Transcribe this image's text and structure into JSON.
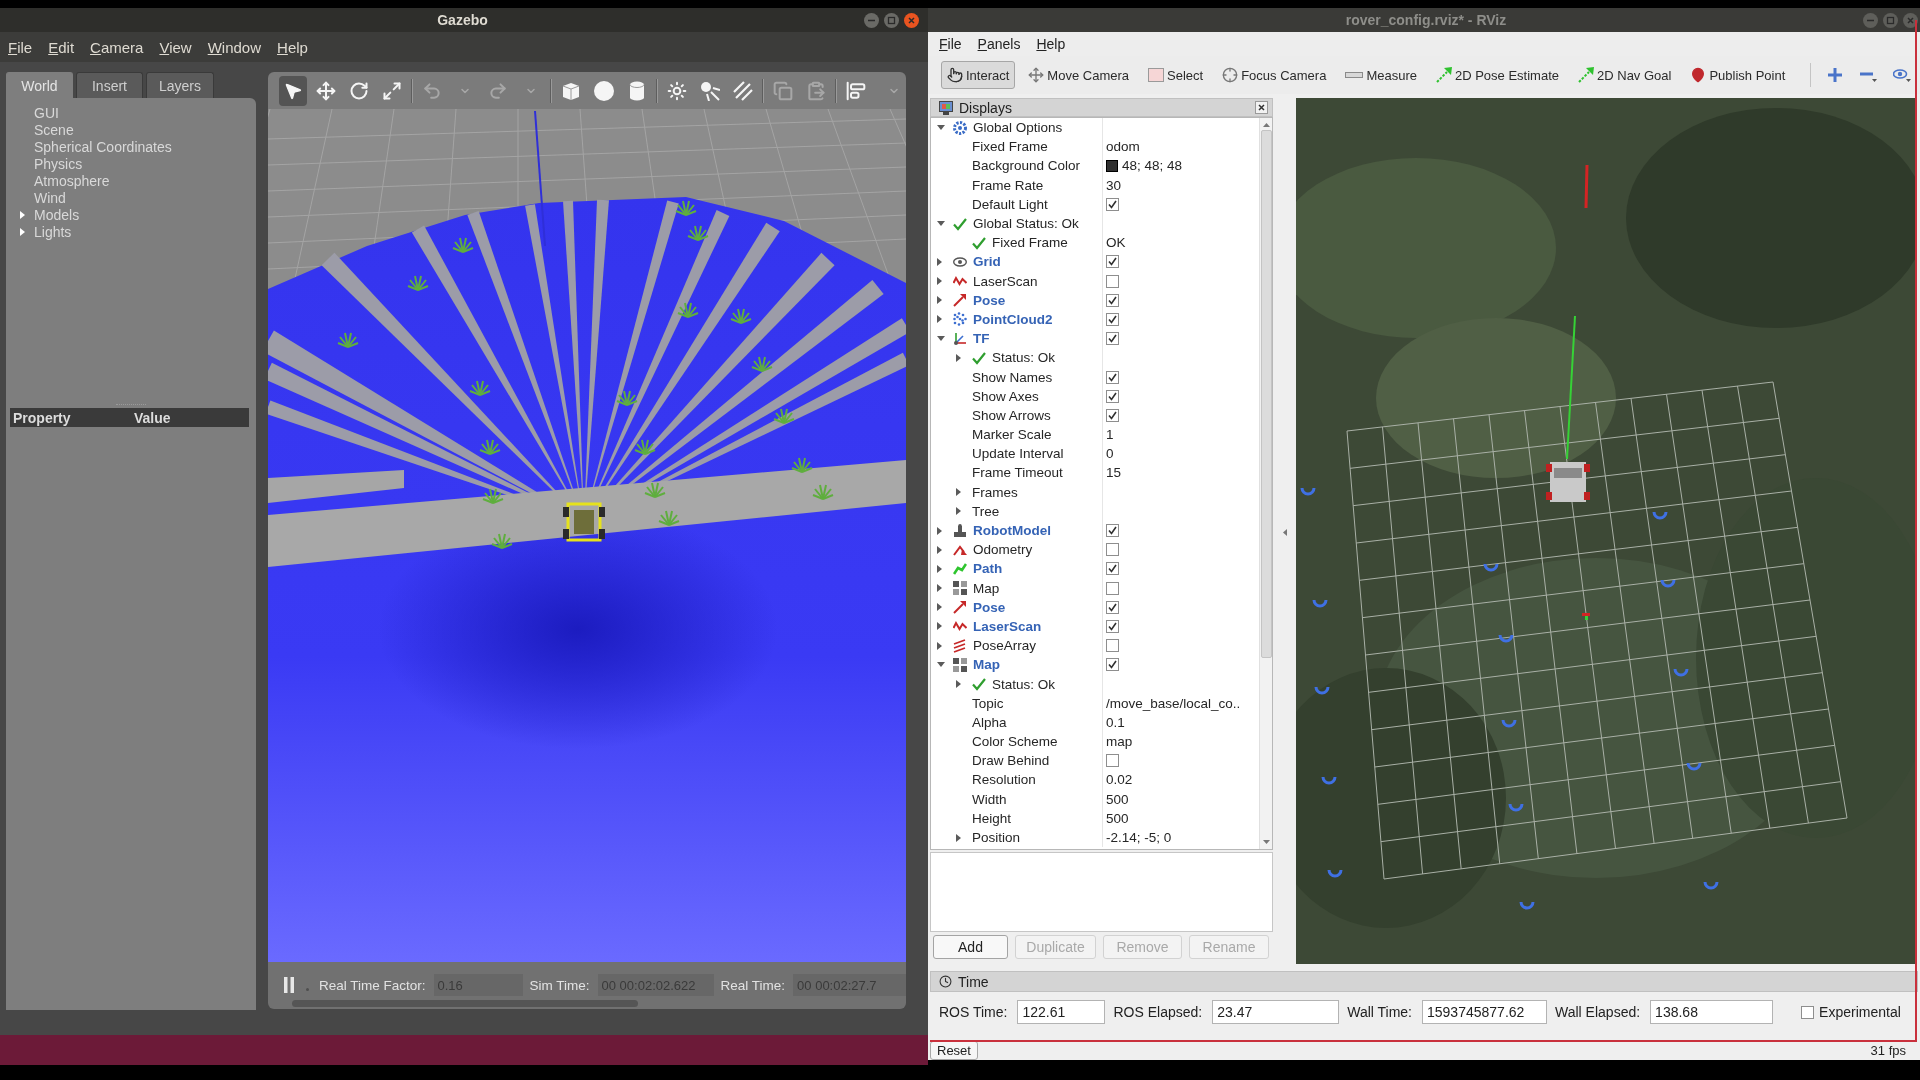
{
  "gazebo": {
    "window": {
      "title": "Gazebo"
    },
    "menu": [
      "File",
      "Edit",
      "Camera",
      "View",
      "Window",
      "Help"
    ],
    "tabs": [
      {
        "label": "World",
        "selected": true
      },
      {
        "label": "Insert",
        "selected": false
      },
      {
        "label": "Layers",
        "selected": false
      }
    ],
    "world_tree": [
      {
        "label": "GUI"
      },
      {
        "label": "Scene"
      },
      {
        "label": "Spherical Coordinates"
      },
      {
        "label": "Physics"
      },
      {
        "label": "Atmosphere"
      },
      {
        "label": "Wind"
      },
      {
        "label": "Models",
        "expanded": false
      },
      {
        "label": "Lights",
        "expanded": false
      }
    ],
    "property_table": {
      "columns": [
        "Property",
        "Value"
      ]
    },
    "toolbar": {
      "groups": [
        [
          {
            "kind": "select",
            "selected": true,
            "disabled": false
          },
          {
            "kind": "translate",
            "selected": false,
            "disabled": false
          },
          {
            "kind": "rotate",
            "selected": false,
            "disabled": false
          },
          {
            "kind": "scale",
            "selected": false,
            "disabled": false
          }
        ],
        [
          {
            "kind": "undo",
            "selected": false,
            "disabled": true
          },
          {
            "kind": "undo-menu",
            "selected": false,
            "disabled": true
          },
          {
            "kind": "redo",
            "selected": false,
            "disabled": true
          },
          {
            "kind": "redo-menu",
            "selected": false,
            "disabled": true
          }
        ],
        [
          {
            "kind": "box",
            "selected": false,
            "disabled": false
          },
          {
            "kind": "sphere",
            "selected": false,
            "disabled": false
          },
          {
            "kind": "cylinder",
            "selected": false,
            "disabled": false
          }
        ],
        [
          {
            "kind": "point-light",
            "selected": false,
            "disabled": false
          },
          {
            "kind": "spot-light",
            "selected": false,
            "disabled": false
          },
          {
            "kind": "directional-light",
            "selected": false,
            "disabled": false
          }
        ],
        [
          {
            "kind": "copy",
            "selected": false,
            "disabled": true
          },
          {
            "kind": "paste",
            "selected": false,
            "disabled": true
          }
        ],
        [
          {
            "kind": "align",
            "selected": false,
            "disabled": false
          },
          {
            "kind": "more",
            "selected": false,
            "disabled": true
          }
        ]
      ]
    },
    "status_bar": {
      "readouts": [
        {
          "label": "Real Time Factor:",
          "value": "0.16"
        },
        {
          "label": "Sim Time:",
          "value": "00 00:02:02.622"
        },
        {
          "label": "Real Time:",
          "value": "00 00:02:27.7"
        }
      ]
    }
  },
  "rviz": {
    "window": {
      "title": "rover_config.rviz* - RViz"
    },
    "menu": [
      "File",
      "Panels",
      "Help"
    ],
    "toolbar": [
      {
        "kind": "interact",
        "label": "Interact",
        "selected": true
      },
      {
        "kind": "move-camera",
        "label": "Move Camera",
        "selected": false
      },
      {
        "kind": "select",
        "label": "Select",
        "selected": false
      },
      {
        "kind": "focus-camera",
        "label": "Focus Camera",
        "selected": false
      },
      {
        "kind": "measure",
        "label": "Measure",
        "selected": false
      },
      {
        "kind": "pose-estimate",
        "label": "2D Pose Estimate",
        "selected": false
      },
      {
        "kind": "nav-goal",
        "label": "2D Nav Goal",
        "selected": false
      },
      {
        "kind": "publish-point",
        "label": "Publish Point",
        "selected": false
      }
    ],
    "displays": {
      "title": "Displays",
      "tree": [
        {
          "label": "Global Options",
          "kind": "options",
          "expanded": true,
          "children": [
            {
              "label": "Fixed Frame",
              "value": "odom"
            },
            {
              "label": "Background Color",
              "value": "48; 48; 48",
              "color": "#303030"
            },
            {
              "label": "Frame Rate",
              "value": "30"
            },
            {
              "label": "Default Light",
              "checked": true
            }
          ]
        },
        {
          "label": "Global Status: Ok",
          "kind": "status",
          "expanded": true,
          "children": [
            {
              "label": "Fixed Frame",
              "kind": "status",
              "value": "OK"
            }
          ]
        },
        {
          "label": "Grid",
          "kind": "grid",
          "expanded": false,
          "checked": true
        },
        {
          "label": "LaserScan",
          "kind": "laser-scan",
          "expanded": false,
          "checked": false
        },
        {
          "label": "Pose",
          "kind": "pose",
          "expanded": false,
          "checked": true
        },
        {
          "label": "PointCloud2",
          "kind": "point-cloud",
          "expanded": false,
          "checked": true
        },
        {
          "label": "TF",
          "kind": "tf",
          "expanded": true,
          "checked": true,
          "children": [
            {
              "label": "Status: Ok",
              "kind": "status",
              "expanded": false
            },
            {
              "label": "Show Names",
              "checked": true
            },
            {
              "label": "Show Axes",
              "checked": true
            },
            {
              "label": "Show Arrows",
              "checked": true
            },
            {
              "label": "Marker Scale",
              "value": "1"
            },
            {
              "label": "Update Interval",
              "value": "0"
            },
            {
              "label": "Frame Timeout",
              "value": "15"
            },
            {
              "label": "Frames",
              "expanded": false
            },
            {
              "label": "Tree",
              "expanded": false
            }
          ]
        },
        {
          "label": "RobotModel",
          "kind": "robot-model",
          "expanded": false,
          "checked": true
        },
        {
          "label": "Odometry",
          "kind": "odometry",
          "expanded": false,
          "checked": false
        },
        {
          "label": "Path",
          "kind": "path",
          "expanded": false,
          "checked": true
        },
        {
          "label": "Map",
          "kind": "map",
          "expanded": false,
          "checked": false
        },
        {
          "label": "Pose",
          "kind": "pose",
          "expanded": false,
          "checked": true
        },
        {
          "label": "LaserScan",
          "kind": "laser-scan",
          "expanded": false,
          "checked": true
        },
        {
          "label": "PoseArray",
          "kind": "pose-array",
          "expanded": false,
          "checked": false
        },
        {
          "label": "Map",
          "kind": "map",
          "expanded": true,
          "checked": true,
          "children": [
            {
              "label": "Status: Ok",
              "kind": "status",
              "expanded": false
            },
            {
              "label": "Topic",
              "value": "/move_base/local_co.."
            },
            {
              "label": "Alpha",
              "value": "0.1"
            },
            {
              "label": "Color Scheme",
              "value": "map"
            },
            {
              "label": "Draw Behind",
              "checked": false
            },
            {
              "label": "Resolution",
              "value": "0.02"
            },
            {
              "label": "Width",
              "value": "500"
            },
            {
              "label": "Height",
              "value": "500"
            },
            {
              "label": "Position",
              "expanded": false,
              "value": "-2.14; -5; 0"
            }
          ]
        }
      ],
      "buttons": [
        {
          "label": "Add",
          "disabled": false
        },
        {
          "label": "Duplicate",
          "disabled": true
        },
        {
          "label": "Remove",
          "disabled": true
        },
        {
          "label": "Rename",
          "disabled": true
        }
      ]
    },
    "time": {
      "title": "Time",
      "fields": [
        {
          "label": "ROS Time:",
          "value": "122.61"
        },
        {
          "label": "ROS Elapsed:",
          "value": "23.47"
        },
        {
          "label": "Wall Time:",
          "value": "1593745877.62"
        },
        {
          "label": "Wall Elapsed:",
          "value": "138.68"
        }
      ],
      "experimental": {
        "label": "Experimental",
        "checked": false
      }
    },
    "status_bar": {
      "reset": "Reset",
      "fps": "31 fps"
    }
  }
}
